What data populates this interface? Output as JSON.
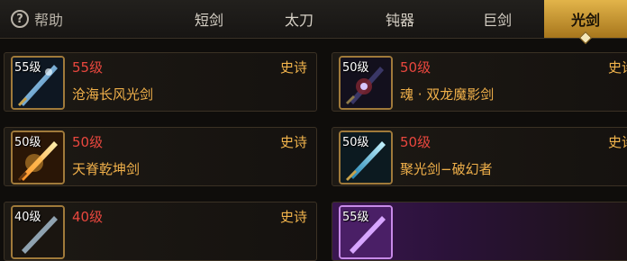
{
  "help": {
    "label": "帮助"
  },
  "tabs": [
    {
      "label": "短剑"
    },
    {
      "label": "太刀"
    },
    {
      "label": "钝器"
    },
    {
      "label": "巨剑"
    },
    {
      "label": "光剑",
      "active": true
    }
  ],
  "items": [
    {
      "icon_level": "55级",
      "level": "55级",
      "name": "沧海长风光剑",
      "rarity": "史诗",
      "icon": "light-blade-icon"
    },
    {
      "icon_level": "50级",
      "level": "50级",
      "name": "魂 · 双龙魔影剑",
      "rarity": "史诗",
      "icon": "dark-blade-icon"
    },
    {
      "icon_level": "50级",
      "level": "50级",
      "name": "天脊乾坤剑",
      "rarity": "史诗",
      "icon": "golden-blade-icon"
    },
    {
      "icon_level": "50级",
      "level": "50级",
      "name": "聚光剑−破幻者",
      "rarity": "史诗",
      "icon": "cyan-blade-icon"
    },
    {
      "icon_level": "40级",
      "level": "40级",
      "name": "",
      "rarity": "史诗",
      "icon": "blade-icon"
    },
    {
      "icon_level": "55级",
      "level": "",
      "name": "",
      "rarity": "",
      "icon": "purple-blade-icon"
    }
  ],
  "colors": {
    "level": "#e9473e",
    "name": "#f0b04a",
    "rarity": "#f2b44c",
    "tab_active": "#e2b44a"
  }
}
